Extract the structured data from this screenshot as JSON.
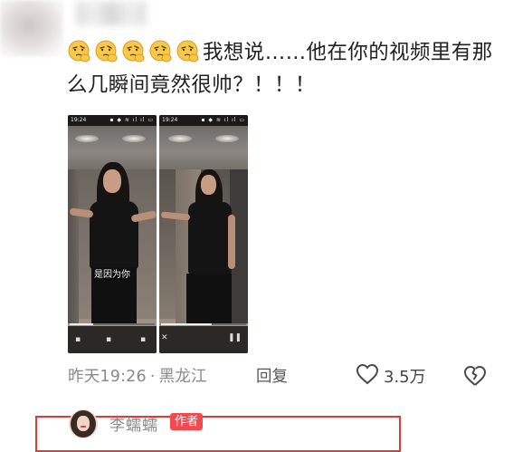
{
  "comment": {
    "emoji_count": 5,
    "emoji_name": "thinking-face-icon",
    "text": "我想说……他在你的视频里有那么几瞬间竟然很帅？！！！",
    "time": "昨天19:26",
    "separator": "·",
    "location": "黑龙江",
    "reply_label": "回复",
    "like_count": "3.5万"
  },
  "attached_videos": [
    {
      "status_time": "19:24",
      "subtitle": "是因为你",
      "progress": 0.28
    },
    {
      "status_time": "19:24",
      "subtitle": "",
      "progress": 0.6
    }
  ],
  "reply": {
    "author": "李蠕蠕",
    "badge": "作者"
  },
  "colors": {
    "badge": "#f5494f",
    "highlight_border": "#e23a3a",
    "meta_text": "#8a8a8a"
  }
}
